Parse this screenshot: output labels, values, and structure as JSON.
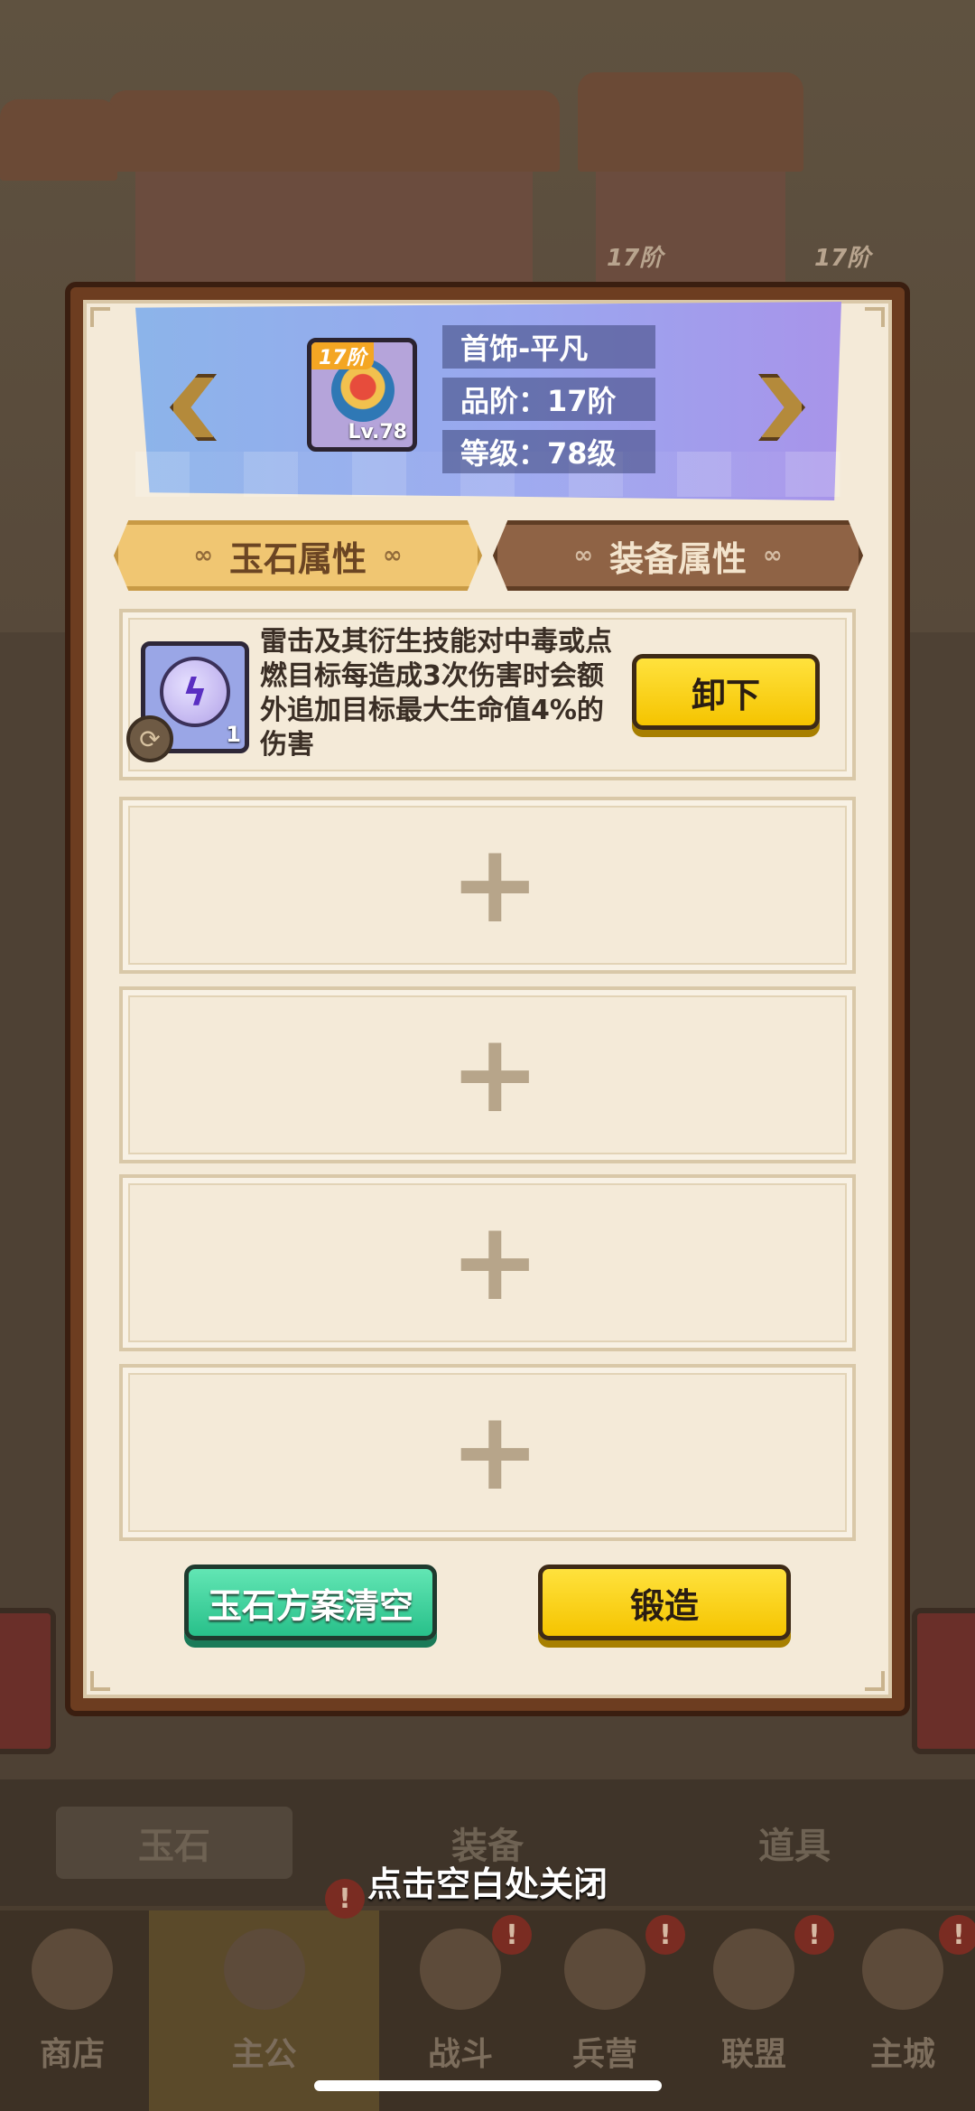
{
  "background": {
    "tier_tags": [
      "17阶",
      "17阶",
      "17阶"
    ],
    "bottom_tabs": [
      "玉石",
      "装备",
      "道具"
    ]
  },
  "close_hint": "点击空白处关闭",
  "nav": [
    {
      "label": "商店",
      "icon": "shop-icon",
      "badge": ""
    },
    {
      "label": "主公",
      "icon": "lord-icon",
      "badge": "!"
    },
    {
      "label": "战斗",
      "icon": "battle-icon",
      "badge": "!"
    },
    {
      "label": "兵营",
      "icon": "barracks-icon",
      "badge": "!"
    },
    {
      "label": "联盟",
      "icon": "alliance-icon",
      "badge": "!"
    },
    {
      "label": "主城",
      "icon": "city-icon",
      "badge": "!"
    }
  ],
  "item": {
    "tier_tag": "17阶",
    "level_tag": "Lv.78",
    "name": "首饰-平凡",
    "grade": "品阶：17阶",
    "level": "等级：78级"
  },
  "tabs": {
    "jade": "玉石属性",
    "equip": "装备属性",
    "ornament": "∞"
  },
  "gem_slot": {
    "icon": "lightning-bubble-icon",
    "count": "1",
    "description": "雷击及其衍生技能对中毒或点燃目标每造成3次伤害时会额外追加目标最大生命值4%的伤害",
    "unequip_label": "卸下"
  },
  "empty_slot_symbol": "+",
  "buttons": {
    "clear_label": "玉石方案清空",
    "forge_label": "锻造"
  },
  "colors": {
    "accent_yellow": "#f5c400",
    "accent_green": "#28c08a",
    "panel_bg": "#f4ead8",
    "tab_active": "#f0c672",
    "tab_inactive": "#8f6345"
  }
}
